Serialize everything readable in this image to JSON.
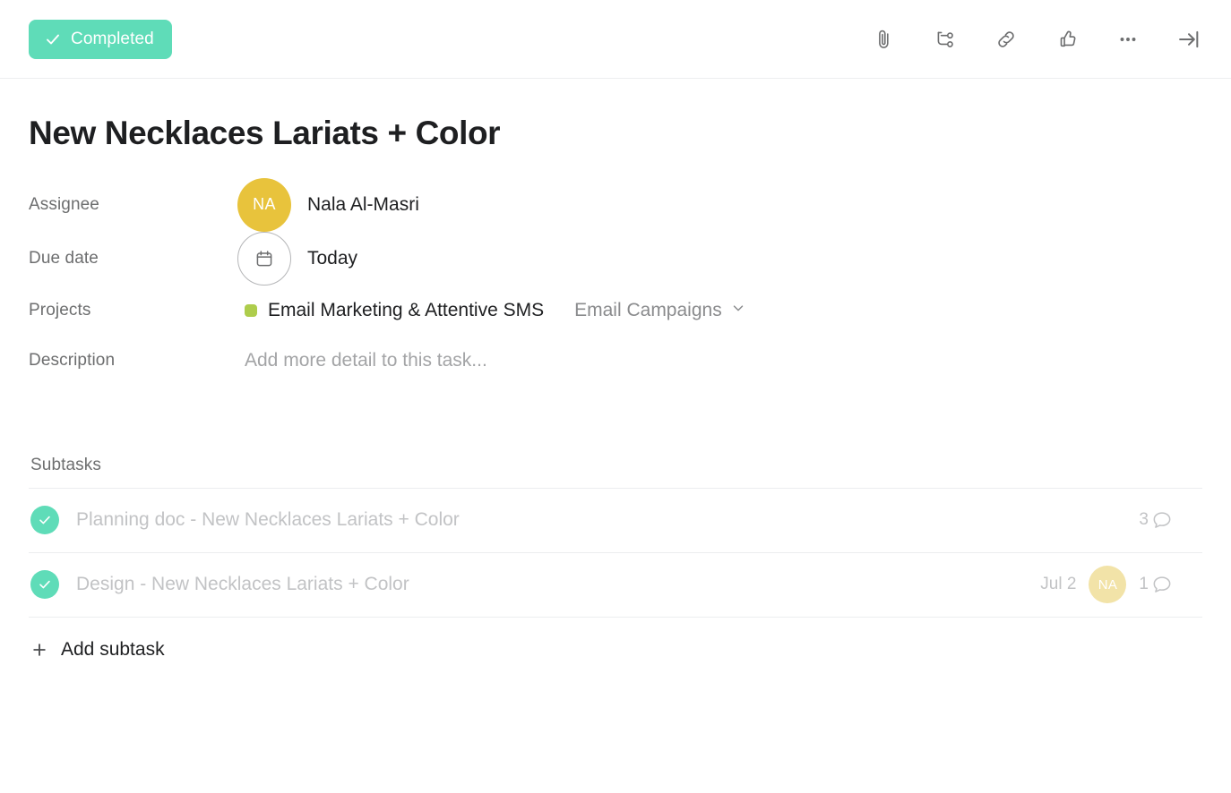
{
  "header": {
    "status_button": {
      "label": "Completed",
      "icon": "check-icon",
      "background_color": "#5fdcb8",
      "text_color": "#ffffff"
    },
    "actions": [
      {
        "name": "attach-icon",
        "tooltip": "Attach"
      },
      {
        "name": "subtask-icon",
        "tooltip": "Add subtask"
      },
      {
        "name": "link-icon",
        "tooltip": "Copy task link"
      },
      {
        "name": "like-icon",
        "tooltip": "Like"
      },
      {
        "name": "more-icon",
        "tooltip": "More actions"
      },
      {
        "name": "collapse-panel-icon",
        "tooltip": "Close details"
      }
    ]
  },
  "task": {
    "title": "New Necklaces Lariats + Color",
    "fields": {
      "assignee": {
        "label": "Assignee",
        "avatar_initials": "NA",
        "avatar_color": "#e8c33c",
        "name": "Nala Al-Masri"
      },
      "due_date": {
        "label": "Due date",
        "value": "Today",
        "icon": "calendar-icon"
      },
      "projects": {
        "label": "Projects",
        "project_name": "Email Marketing & Attentive SMS",
        "project_color": "#aecd4c",
        "section_name": "Email Campaigns",
        "section_chevron": "chevron-down-icon"
      },
      "description": {
        "label": "Description",
        "placeholder": "Add more detail to this task..."
      }
    }
  },
  "subtasks": {
    "heading": "Subtasks",
    "add_label": "Add subtask",
    "add_icon": "plus-icon",
    "items": [
      {
        "name": "Planning doc - New Necklaces Lariats + Color",
        "completed": true,
        "due_date": "",
        "assignee_initials": "",
        "comment_count": "3"
      },
      {
        "name": "Design - New Necklaces Lariats + Color",
        "completed": true,
        "due_date": "Jul 2",
        "assignee_initials": "NA",
        "comment_count": "1"
      }
    ]
  }
}
